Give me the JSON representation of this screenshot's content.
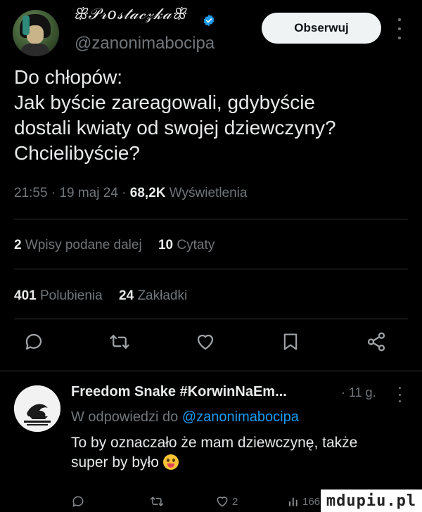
{
  "header": {
    "display_name": "ꕥ𝒫𝓇𝑜𝓈𝓉𝒶𝒸𝓏𝓀𝒶ꕥ",
    "handle": "@zanonimabocipa",
    "follow_label": "Obserwuj"
  },
  "tweet": {
    "lines": [
      "Do chłopów:",
      "Jak byście zareagowali, gdybyście",
      "dostali kwiaty od swojej dziewczyny?",
      "Chcielibyście?"
    ],
    "time": "21:55",
    "date": "19 maj 24",
    "views_count": "68,2K",
    "views_label": "Wyświetlenia",
    "sep": "·"
  },
  "stats": {
    "reposts_count": "2",
    "reposts_label": "Wpisy podane dalej",
    "quotes_count": "10",
    "quotes_label": "Cytaty",
    "likes_count": "401",
    "likes_label": "Polubienia",
    "bookmarks_count": "24",
    "bookmarks_label": "Zakładki"
  },
  "reply": {
    "name": "Freedom Snake #KorwinNaEm...",
    "time": "· 11 g.",
    "reply_to_prefix": "W odpowiedzi do",
    "reply_to_handle": "@zanonimabocipa",
    "text_line1": "To by oznaczało że mam dziewczynę, także",
    "text_line2": "super by było",
    "likes": "2",
    "views": "166"
  },
  "watermark": "mdupiu.pl",
  "icons": {
    "reply": "comment-icon",
    "repost": "repost-icon",
    "like": "heart-icon",
    "bookmark": "bookmark-icon",
    "share": "share-icon"
  },
  "colors": {
    "background": "#000000",
    "text": "#e7e9ea",
    "muted": "#71767b",
    "accent": "#1d9bf0",
    "divider": "#2f3336"
  }
}
